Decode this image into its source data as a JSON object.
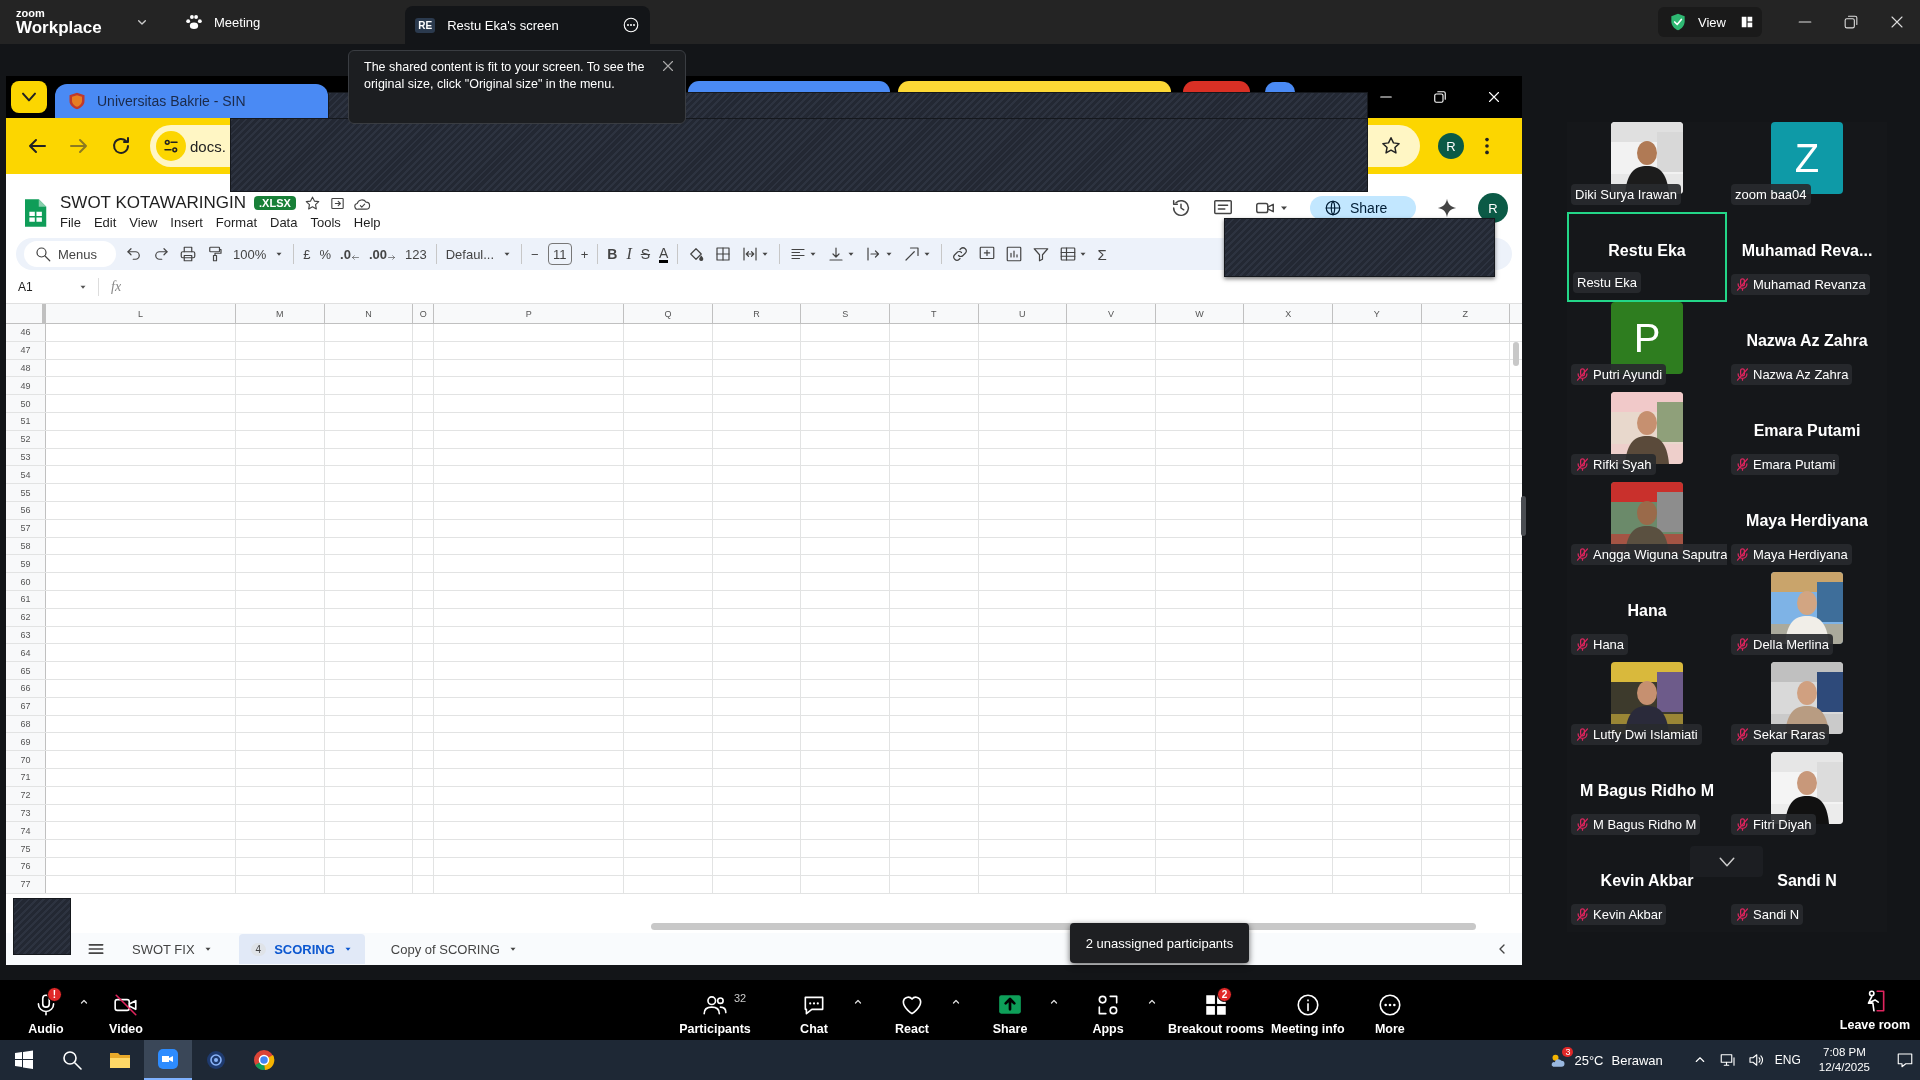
{
  "zoom_bar": {
    "logo_top": "zoom",
    "logo_bottom": "Workplace",
    "meeting": "Meeting",
    "share_tab": {
      "initials": "RE",
      "title": "Restu Eka's screen"
    },
    "view": "View"
  },
  "notice": {
    "text": "The shared content is fit to your screen. To see the original size, click \"Original size\" in the menu."
  },
  "browser": {
    "tabs": [
      {
        "kind": "tab",
        "title": "Universitas Bakrie - SIN",
        "color": "#4a8af4"
      },
      {
        "kind": "tab",
        "color": "#4a8af4"
      },
      {
        "kind": "tab",
        "color": "#fdd835"
      },
      {
        "kind": "tab",
        "color": "#d93025"
      },
      {
        "kind": "circle",
        "color": "#4a8af4"
      }
    ],
    "url": "docs.",
    "profile": "R"
  },
  "sheet": {
    "title": "SWOT KOTAWARINGIN",
    "badge": ".XLSX",
    "menus": [
      "File",
      "Edit",
      "View",
      "Insert",
      "Format",
      "Data",
      "Tools",
      "Help"
    ],
    "share": "Share",
    "profile": "R",
    "toolbar": {
      "search": "Menus",
      "zoom": "100%",
      "currency": "£",
      "percent": "%",
      "decimal_less": ".0",
      "decimal_more": ".00",
      "format": "123",
      "font": "Defaul...",
      "minus": "−",
      "size": "11",
      "plus": "+",
      "bold": "B",
      "italic": "I",
      "strike": "S",
      "text_color": "A",
      "sum": "Σ"
    },
    "name_box": "A1",
    "fx": "fx",
    "columns": [
      {
        "label": "L",
        "kind": "wide"
      },
      {
        "label": "M",
        "kind": "normal"
      },
      {
        "label": "N",
        "kind": "normal"
      },
      {
        "label": "O",
        "kind": "narrow"
      },
      {
        "label": "P",
        "kind": "wide"
      },
      {
        "label": "Q",
        "kind": "normal"
      },
      {
        "label": "R",
        "kind": "normal"
      },
      {
        "label": "S",
        "kind": "normal"
      },
      {
        "label": "T",
        "kind": "normal"
      },
      {
        "label": "U",
        "kind": "normal"
      },
      {
        "label": "V",
        "kind": "normal"
      },
      {
        "label": "W",
        "kind": "normal"
      },
      {
        "label": "X",
        "kind": "normal"
      },
      {
        "label": "Y",
        "kind": "normal"
      },
      {
        "label": "Z",
        "kind": "normal"
      }
    ],
    "rows": [
      "46",
      "47",
      "48",
      "49",
      "50",
      "51",
      "52",
      "53",
      "54",
      "55",
      "56",
      "57",
      "58",
      "59",
      "60",
      "61",
      "62",
      "63",
      "64",
      "65",
      "66",
      "67",
      "68",
      "69",
      "70",
      "71",
      "72",
      "73",
      "74",
      "75",
      "76",
      "77"
    ],
    "tabs": [
      {
        "label": "SWOT FIX",
        "selected": false
      },
      {
        "badge": "4",
        "label": "SCORING",
        "selected": true
      },
      {
        "label": "Copy of SCORING",
        "selected": false
      }
    ]
  },
  "gallery": {
    "participants": [
      {
        "name": "Diki Surya Irawan",
        "muted": false,
        "selected": false
      },
      {
        "name": "zoom baa04",
        "kind": "avatar",
        "letter": "Z",
        "color": "#0e9aa7",
        "muted": false,
        "selected": false
      },
      {
        "name": "Restu Eka",
        "heading": "Restu Eka",
        "kind": "name",
        "muted": false,
        "selected": true
      },
      {
        "name": "Muhamad Revanza",
        "heading": "Muhamad Reva...",
        "kind": "name",
        "muted": true,
        "selected": false
      },
      {
        "name": "Putri Ayundi",
        "kind": "avatar",
        "letter": "P",
        "color": "#2e7d1f",
        "muted": true,
        "selected": false
      },
      {
        "name": "Nazwa Az Zahra",
        "heading": "Nazwa Az Zahra",
        "kind": "name",
        "muted": true,
        "selected": false
      },
      {
        "name": "Rifki Syah",
        "muted": true,
        "selected": false
      },
      {
        "name": "Emara Putami",
        "heading": "Emara Putami",
        "kind": "name",
        "muted": true,
        "selected": false
      },
      {
        "name": "Angga Wiguna Saputra",
        "muted": true,
        "selected": false
      },
      {
        "name": "Maya Herdiyana",
        "heading": "Maya Herdiyana",
        "kind": "name",
        "muted": true,
        "selected": false
      },
      {
        "name": "Hana",
        "heading": "Hana",
        "kind": "name",
        "muted": true,
        "selected": false
      },
      {
        "name": "Della Merlina",
        "muted": true,
        "selected": false
      },
      {
        "name": "Lutfy Dwi Islamiati",
        "muted": true,
        "selected": false
      },
      {
        "name": "Sekar Raras",
        "muted": true,
        "selected": false
      },
      {
        "name": "M Bagus Ridho M",
        "heading": "M Bagus Ridho M",
        "kind": "name",
        "muted": true,
        "selected": false
      },
      {
        "name": "Fitri Diyah",
        "muted": true,
        "selected": false
      },
      {
        "name": "Kevin Akbar",
        "heading": "Kevin Akbar",
        "kind": "name",
        "muted": true,
        "selected": false
      },
      {
        "name": "Sandi N",
        "heading": "Sandi N",
        "kind": "name",
        "muted": true,
        "selected": false
      }
    ]
  },
  "controls": {
    "left": [
      {
        "kind": "audio",
        "label": "Audio",
        "badge": "!",
        "menu": true
      },
      {
        "kind": "video",
        "label": "Video",
        "off": true,
        "menu": false
      }
    ],
    "center": [
      {
        "kind": "participants",
        "label": "Participants",
        "count": "32",
        "menu": false
      },
      {
        "kind": "chat",
        "label": "Chat",
        "menu": true
      },
      {
        "kind": "react",
        "label": "React",
        "menu": true
      },
      {
        "kind": "share",
        "label": "Share",
        "menu": true
      },
      {
        "kind": "apps",
        "label": "Apps",
        "menu": true
      },
      {
        "kind": "breakout",
        "label": "Breakout rooms",
        "badge": "2",
        "menu": false
      },
      {
        "kind": "info",
        "label": "Meeting info",
        "menu": false
      },
      {
        "kind": "more",
        "label": "More",
        "menu": false
      }
    ],
    "tooltip": "2 unassigned participants",
    "leave": "Leave room"
  },
  "taskbar": {
    "apps": [
      {
        "kind": "start",
        "selected": false
      },
      {
        "kind": "search",
        "selected": false
      },
      {
        "kind": "files",
        "selected": false
      },
      {
        "kind": "zoom",
        "selected": true
      },
      {
        "kind": "camera",
        "selected": false
      },
      {
        "kind": "chrome",
        "selected": false
      }
    ],
    "weather": {
      "badge": "3",
      "temp": "25°C",
      "text": "Berawan"
    },
    "lang": "ENG",
    "time": "7:08 PM",
    "date": "12/4/2025"
  }
}
